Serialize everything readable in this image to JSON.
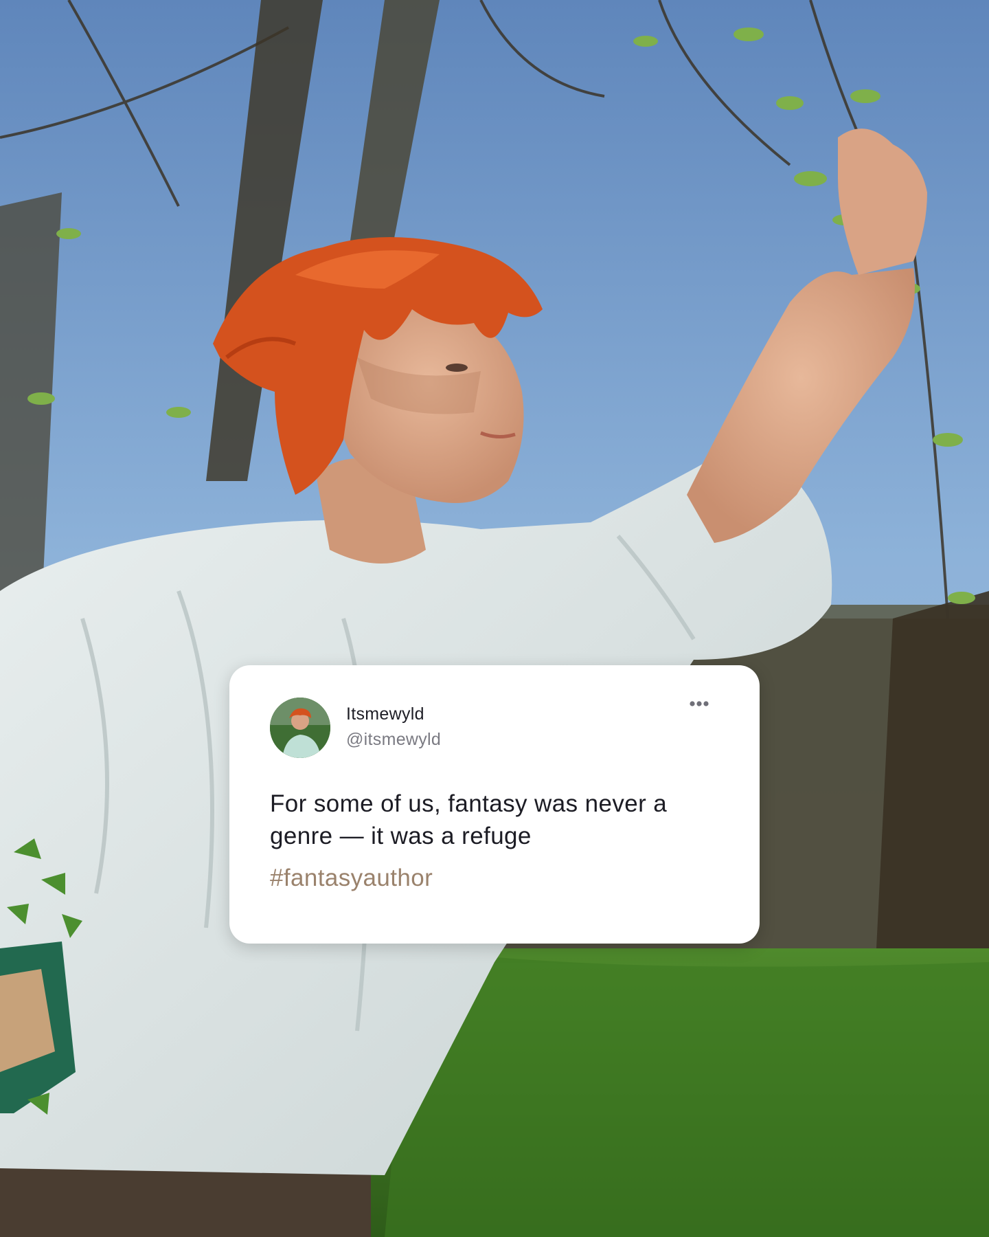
{
  "post": {
    "display_name": "Itsmewyld",
    "handle": "@itsmewyld",
    "text": "For some of us, fantasy was never a genre — it was a refuge",
    "hashtag": "#fantasyauthor",
    "more_icon": "more-horizontal-icon"
  },
  "colors": {
    "card_background": "#ffffff",
    "text_primary": "#1c1c24",
    "text_secondary": "#7a7a82",
    "hashtag": "#9a826c",
    "hair_accent": "#d4521e"
  }
}
